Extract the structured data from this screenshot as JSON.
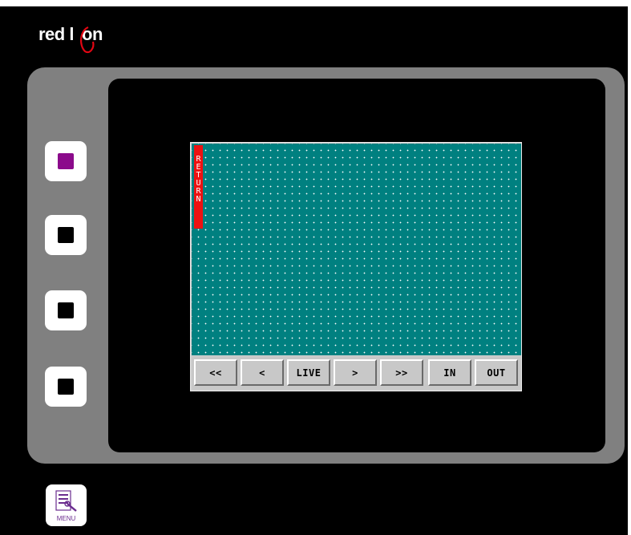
{
  "brand": {
    "logo_text_left": "red l",
    "logo_text_right": "on",
    "logo_text": "red lion"
  },
  "soft_keys": [
    {
      "name": "soft-key-1",
      "state": "active"
    },
    {
      "name": "soft-key-2",
      "state": "idle"
    },
    {
      "name": "soft-key-3",
      "state": "idle"
    },
    {
      "name": "soft-key-4",
      "state": "idle"
    }
  ],
  "hmi": {
    "return_label": [
      "R",
      "E",
      "T",
      "U",
      "R",
      "N"
    ],
    "toolbar": {
      "first": "<<",
      "prev": "<",
      "live": "LIVE",
      "next": ">",
      "last": ">>",
      "zoom_in": "IN",
      "zoom_out": "OUT"
    }
  },
  "menu": {
    "label": "MENU"
  },
  "colors": {
    "bezel": "#808080",
    "canvas": "#008080",
    "return": "#ee1111",
    "active_key": "#8b0a8b",
    "menu_accent": "#6b2d8f"
  }
}
